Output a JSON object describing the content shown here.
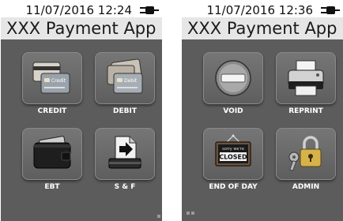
{
  "screens": [
    {
      "status_time": "11/07/2016 12:24",
      "app_title": "XXX Payment App",
      "tiles": [
        {
          "label": "CREDIT",
          "icon": "credit-card-icon",
          "card_text": "Credit"
        },
        {
          "label": "DEBIT",
          "icon": "debit-card-icon",
          "card_text": "Debit"
        },
        {
          "label": "EBT",
          "icon": "wallet-icon"
        },
        {
          "label": "S & F",
          "icon": "store-and-forward-icon"
        }
      ]
    },
    {
      "status_time": "11/07/2016 12:36",
      "app_title": "XXX Payment App",
      "tiles": [
        {
          "label": "VOID",
          "icon": "no-entry-icon"
        },
        {
          "label": "REPRINT",
          "icon": "printer-icon"
        },
        {
          "label": "END OF DAY",
          "icon": "closed-sign-icon",
          "sign_top": "sorry we're",
          "sign_main": "CLOSED"
        },
        {
          "label": "ADMIN",
          "icon": "padlock-key-icon"
        }
      ]
    }
  ],
  "colors": {
    "panel": "#5c5c5c",
    "titlebar": "#e6e6e6",
    "tile": "#6a6a6a",
    "label": "#ffffff"
  }
}
